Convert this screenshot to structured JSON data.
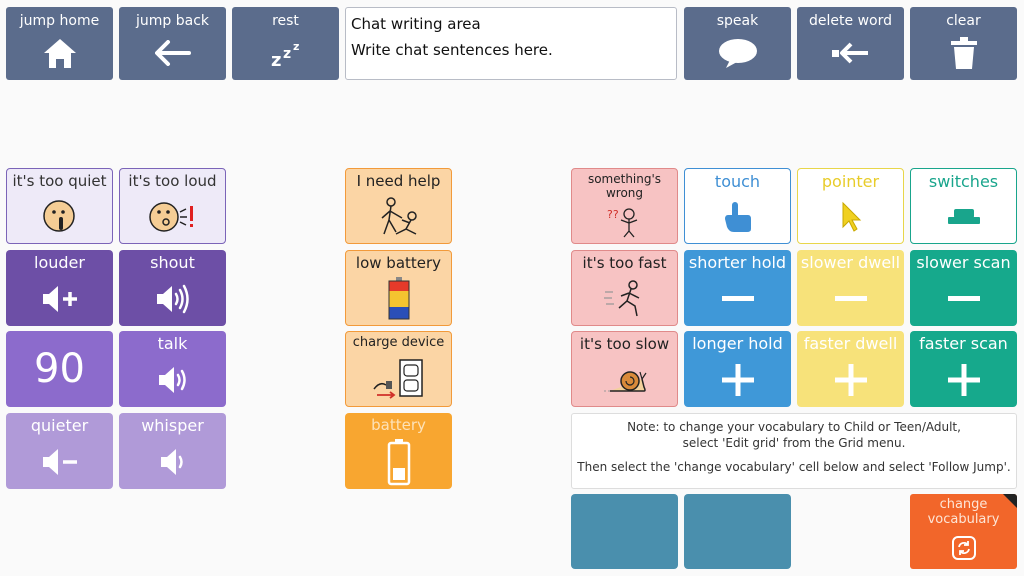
{
  "toolbar": {
    "jump_home": "jump home",
    "jump_back": "jump back",
    "rest": "rest",
    "speak": "speak",
    "delete_word": "delete word",
    "clear": "clear"
  },
  "chat": {
    "title": "Chat writing area",
    "placeholder": "Write chat sentences here."
  },
  "volume": {
    "too_quiet": "it's too quiet",
    "too_loud": "it's too loud",
    "louder": "louder",
    "shout": "shout",
    "level": "90",
    "talk": "talk",
    "quieter": "quieter",
    "whisper": "whisper"
  },
  "help": {
    "need_help": "I need help",
    "low_battery": "low battery",
    "charge_device": "charge device",
    "battery": "battery"
  },
  "access": {
    "something_wrong": "something's wrong",
    "touch": "touch",
    "pointer": "pointer",
    "switches": "switches",
    "too_fast": "it's too fast",
    "shorter_hold": "shorter hold",
    "slower_dwell": "slower dwell",
    "slower_scan": "slower scan",
    "too_slow": "it's too slow",
    "longer_hold": "longer hold",
    "faster_dwell": "faster dwell",
    "faster_scan": "faster scan"
  },
  "note": {
    "line1": "Note: to change your vocabulary to Child or Teen/Adult,",
    "line2": "select 'Edit grid' from the Grid menu.",
    "line3": "Then select the 'change vocabulary' cell below and select 'Follow Jump'."
  },
  "change_vocabulary": "change vocabulary",
  "colors": {
    "toolbar": "#5b6c8c",
    "purple_dark": "#6d4fa6",
    "orange": "#f8a630",
    "blue": "#3f98d8",
    "yellow": "#f7e27a",
    "teal": "#16a98c",
    "change": "#f2662a"
  }
}
